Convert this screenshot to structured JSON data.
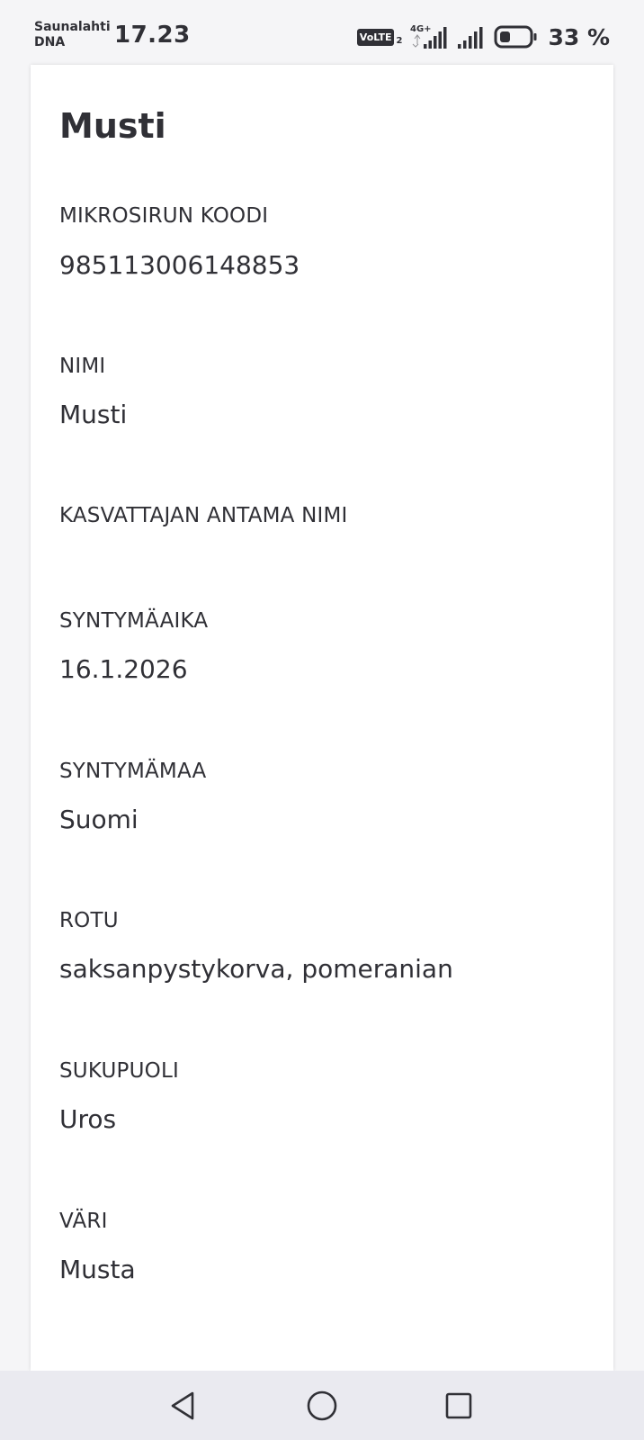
{
  "status_bar": {
    "carrier_line1": "Saunalahti",
    "carrier_line2": "DNA",
    "time": "17.23",
    "volte": "VoLTE",
    "volte_sub": "2",
    "network": "4G+",
    "battery_percent": "33 %",
    "battery_level": 0.33
  },
  "pet": {
    "title": "Musti",
    "fields": [
      {
        "label": "MIKROSIRUN KOODI",
        "value": "985113006148853"
      },
      {
        "label": "NIMI",
        "value": "Musti"
      },
      {
        "label": "KASVATTAJAN ANTAMA NIMI",
        "value": ""
      },
      {
        "label": "SYNTYMÄAIKA",
        "value": "16.1.2026"
      },
      {
        "label": "SYNTYMÄMAA",
        "value": "Suomi"
      },
      {
        "label": "ROTU",
        "value": "saksanpystykorva, pomeranian"
      },
      {
        "label": "SUKUPUOLI",
        "value": "Uros"
      },
      {
        "label": "VÄRI",
        "value": "Musta"
      }
    ]
  },
  "nav": {
    "back_icon": "back-triangle-icon",
    "home_icon": "home-circle-icon",
    "recents_icon": "recents-square-icon"
  }
}
